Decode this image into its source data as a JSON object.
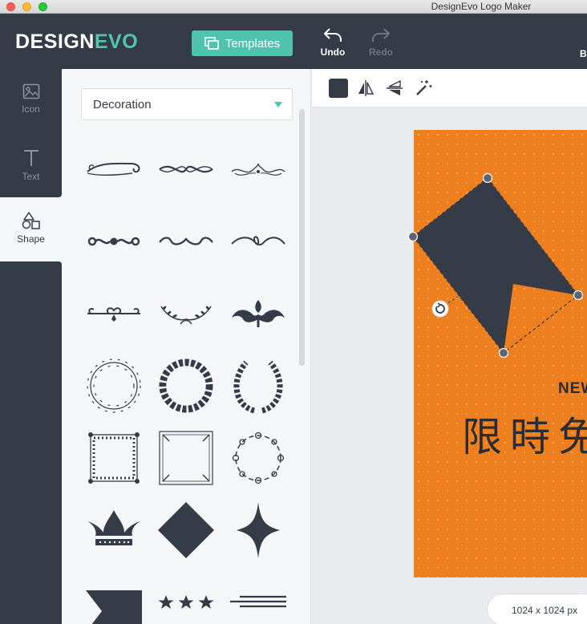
{
  "window": {
    "title": "DesignEvo Logo Maker"
  },
  "header": {
    "logo_part1": "DESIGN",
    "logo_part2": "EVO",
    "templates_label": "Templates",
    "undo_label": "Undo",
    "redo_label": "Redo",
    "cut_label": "B"
  },
  "sidebar": {
    "items": [
      {
        "label": "Icon",
        "icon": "image-icon",
        "active": false
      },
      {
        "label": "Text",
        "icon": "text-icon",
        "active": false
      },
      {
        "label": "Shape",
        "icon": "shapes-icon",
        "active": true
      }
    ]
  },
  "panel": {
    "category": "Decoration",
    "shapes": [
      "flourish-1",
      "flourish-2",
      "flourish-3",
      "divider-1",
      "divider-2",
      "divider-3",
      "ornament-1",
      "laurel-branch",
      "ornament-crest",
      "wreath-thin",
      "wreath-bold",
      "laurel-wreath",
      "frame-ornate",
      "frame-corners",
      "frame-swirl",
      "crown",
      "diamond",
      "four-point-star",
      "ribbon-banner",
      "three-stars",
      "lines-divider"
    ]
  },
  "canvas": {
    "artboard_color": "#ee7f1f",
    "shape_color": "#353c48",
    "text_new": "NEW",
    "text_cn": "限時免",
    "size_label": "1024 x 1024 px"
  },
  "colors": {
    "accent": "#4fc3ad",
    "dark": "#353c48",
    "muted": "#8c94a1"
  }
}
